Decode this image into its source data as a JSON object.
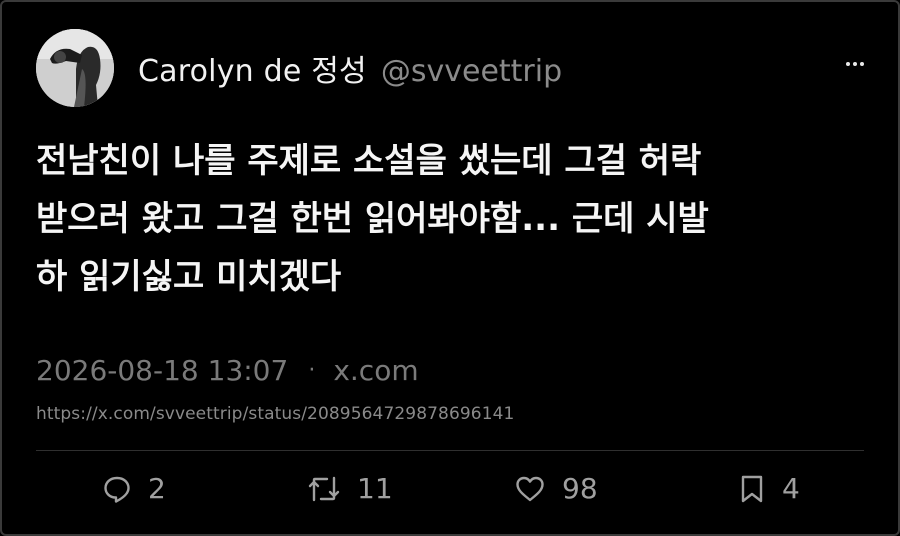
{
  "author": {
    "display_name": "Carolyn de 정성",
    "handle": "@svveettrip"
  },
  "tweet": {
    "lines": [
      "전남친이 나를 주제로 소설을 썼는데 그걸 허락",
      "받으러 왔고 그걸 한번 읽어봐야함... 근데 시발",
      "하 읽기싫고 미치겠다"
    ]
  },
  "meta": {
    "timestamp": "2026-08-18 13:07",
    "separator": "·",
    "source": "x.com",
    "url": "https://x.com/svveettrip/status/2089564729878696141"
  },
  "actions": {
    "replies": "2",
    "retweets": "11",
    "likes": "98",
    "bookmarks": "4"
  },
  "icons": {
    "more": "more-horizontal-icon",
    "reply": "reply-bubble-icon",
    "retweet": "retweet-icon",
    "like": "heart-icon",
    "bookmark": "bookmark-icon"
  },
  "colors": {
    "background": "#000000",
    "text": "#f5f5f5",
    "muted": "#7a7a7a"
  }
}
